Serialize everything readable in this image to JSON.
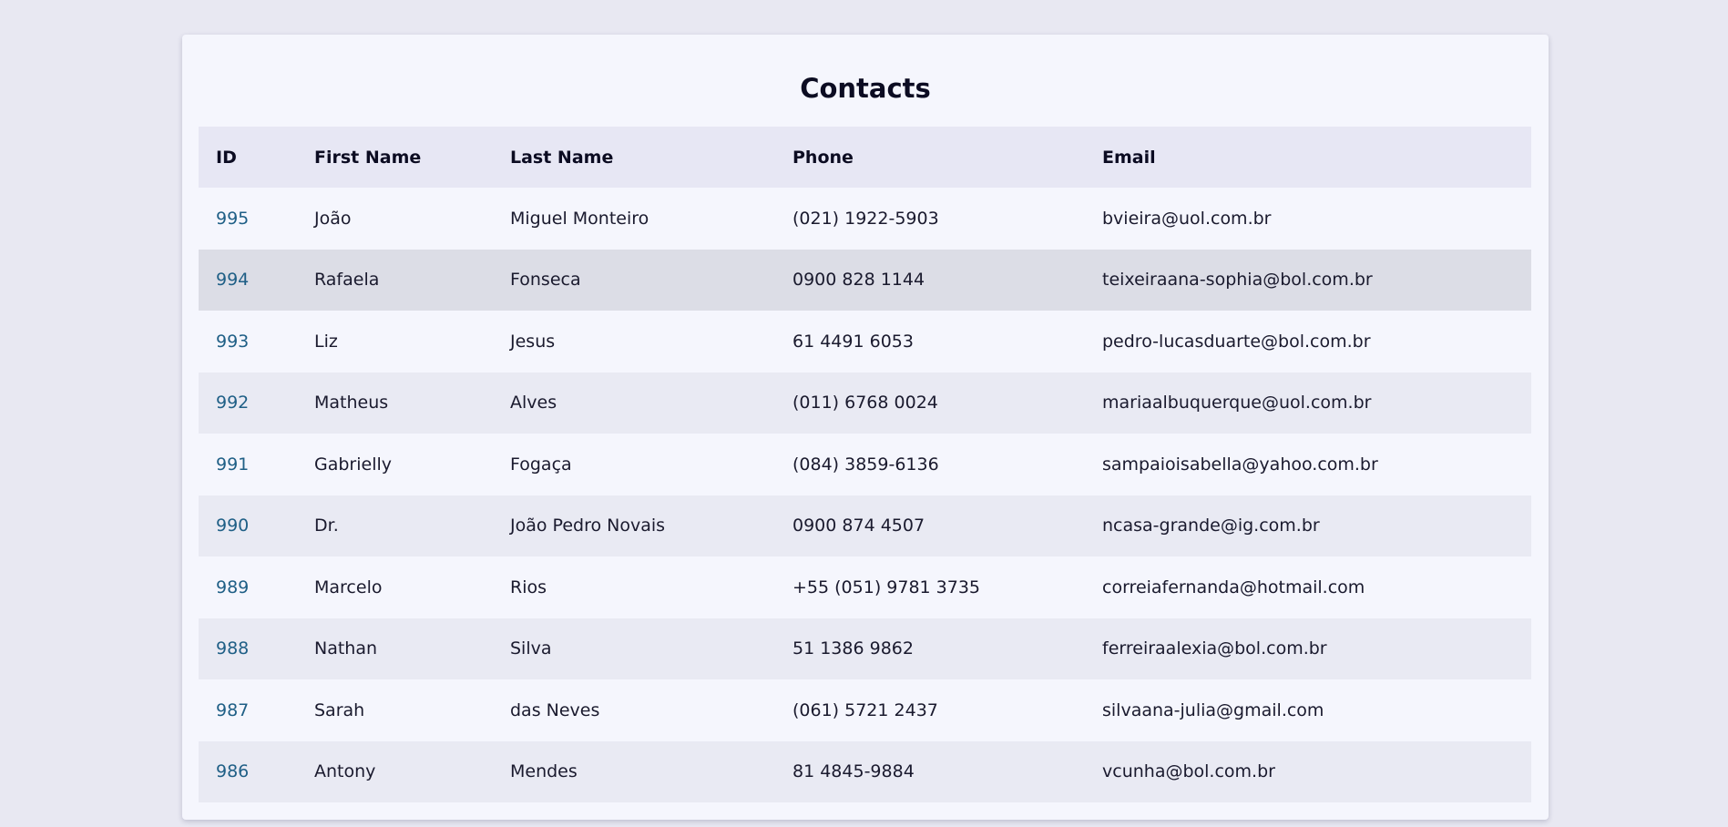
{
  "page": {
    "title": "Contacts"
  },
  "table": {
    "headers": {
      "id": "ID",
      "first_name": "First Name",
      "last_name": "Last Name",
      "phone": "Phone",
      "email": "Email"
    },
    "rows": [
      {
        "id": "995",
        "first_name": "João",
        "last_name": "Miguel Monteiro",
        "phone": "(021) 1922-5903",
        "email": "bvieira@uol.com.br"
      },
      {
        "id": "994",
        "first_name": "Rafaela",
        "last_name": "Fonseca",
        "phone": "0900 828 1144",
        "email": "teixeiraana-sophia@bol.com.br"
      },
      {
        "id": "993",
        "first_name": "Liz",
        "last_name": "Jesus",
        "phone": "61 4491 6053",
        "email": "pedro-lucasduarte@bol.com.br"
      },
      {
        "id": "992",
        "first_name": "Matheus",
        "last_name": "Alves",
        "phone": "(011) 6768 0024",
        "email": "mariaalbuquerque@uol.com.br"
      },
      {
        "id": "991",
        "first_name": "Gabrielly",
        "last_name": "Fogaça",
        "phone": "(084) 3859-6136",
        "email": "sampaioisabella@yahoo.com.br"
      },
      {
        "id": "990",
        "first_name": "Dr.",
        "last_name": "João Pedro Novais",
        "phone": "0900 874 4507",
        "email": "ncasa-grande@ig.com.br"
      },
      {
        "id": "989",
        "first_name": "Marcelo",
        "last_name": "Rios",
        "phone": "+55 (051) 9781 3735",
        "email": "correiafernanda@hotmail.com"
      },
      {
        "id": "988",
        "first_name": "Nathan",
        "last_name": "Silva",
        "phone": "51 1386 9862",
        "email": "ferreiraalexia@bol.com.br"
      },
      {
        "id": "987",
        "first_name": "Sarah",
        "last_name": "das Neves",
        "phone": "(061) 5721 2437",
        "email": "silvaana-julia@gmail.com"
      },
      {
        "id": "986",
        "first_name": "Antony",
        "last_name": "Mendes",
        "phone": "81 4845-9884",
        "email": "vcunha@bol.com.br"
      }
    ]
  },
  "colors": {
    "page_background": "#e8e8f2",
    "card_background": "#f5f6fd",
    "header_background": "#e7e7f4",
    "striped_row": "#e9eaf3",
    "hovered_row": "#dcdde6",
    "id_link": "#1f5f86"
  }
}
